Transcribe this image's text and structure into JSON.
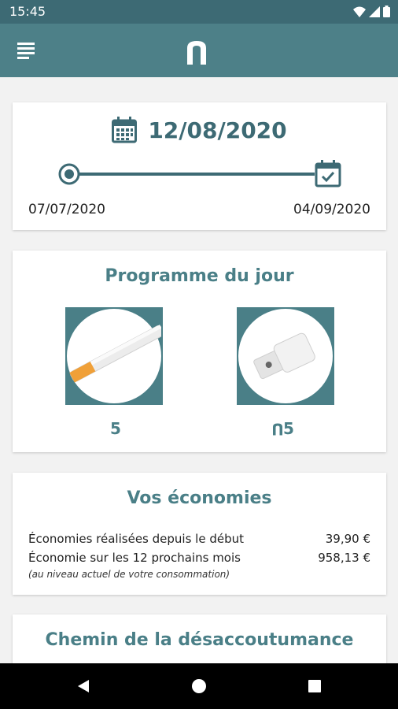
{
  "status_bar": {
    "time": "15:45",
    "icons": [
      "wifi-icon",
      "signal-icon",
      "battery-icon"
    ]
  },
  "app_bar": {
    "menu_icon": "menu-icon",
    "logo": "app-logo-n"
  },
  "date_card": {
    "current_date": "12/08/2020",
    "start_date": "07/07/2020",
    "end_date": "04/09/2020",
    "icons": [
      "calendar-icon",
      "timeline-start-icon",
      "calendar-check-icon"
    ]
  },
  "programme": {
    "title": "Programme du jour",
    "items": [
      {
        "name": "cigarette",
        "count": "5"
      },
      {
        "name": "nicotine-device",
        "count": "5",
        "prefix_icon": "app-logo-n"
      }
    ]
  },
  "economies": {
    "title": "Vos économies",
    "rows": [
      {
        "label": "Économies réalisées depuis le début",
        "value": "39,90 €"
      },
      {
        "label": "Économie sur les 12 prochains mois",
        "value": "958,13 €"
      }
    ],
    "note": "(au niveau actuel de votre consommation)"
  },
  "chemin": {
    "title": "Chemin de la désaccoutumance"
  },
  "nav_bar": {
    "buttons": [
      "back-button",
      "home-button",
      "recents-button"
    ]
  },
  "colors": {
    "status_bar": "#3d6a74",
    "app_bar": "#4d8088",
    "accent": "#4a7f87",
    "background": "#f2f2f2"
  }
}
